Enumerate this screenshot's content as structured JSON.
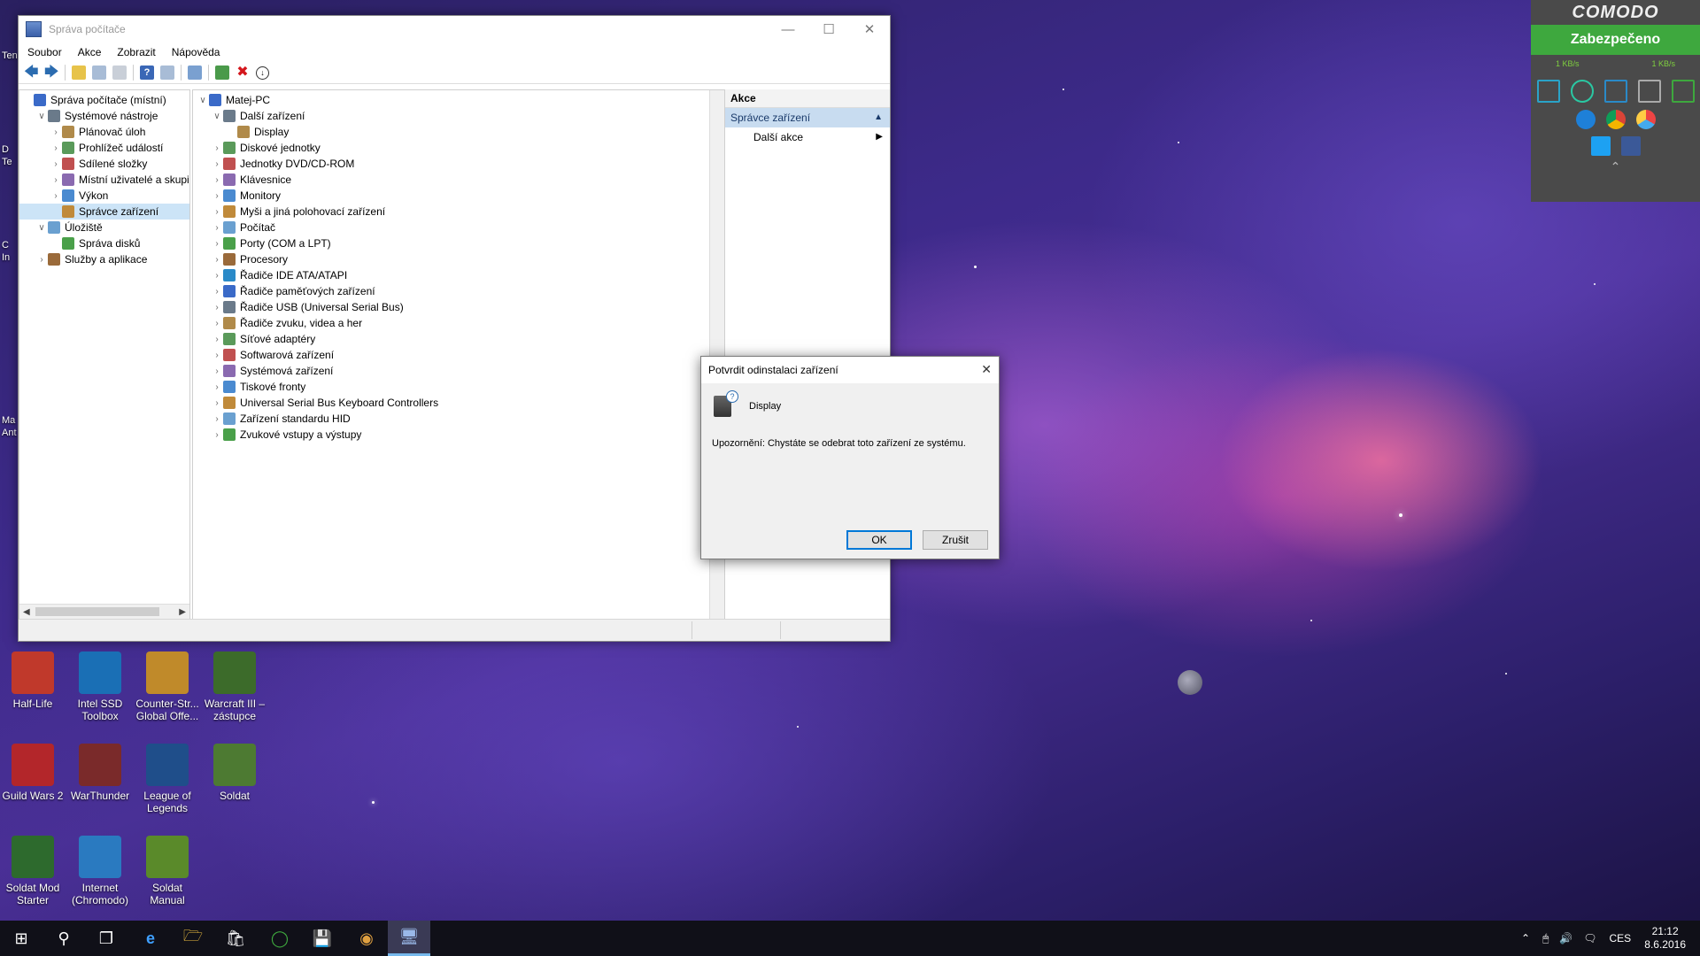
{
  "window": {
    "title": "Správa počítače",
    "menu": [
      "Soubor",
      "Akce",
      "Zobrazit",
      "Nápověda"
    ],
    "left_tree": [
      {
        "label": "Správa počítače (místní)",
        "indent": 0,
        "toggle": ""
      },
      {
        "label": "Systémové nástroje",
        "indent": 1,
        "toggle": "v"
      },
      {
        "label": "Plánovač úloh",
        "indent": 2,
        "toggle": ">"
      },
      {
        "label": "Prohlížeč událostí",
        "indent": 2,
        "toggle": ">"
      },
      {
        "label": "Sdílené složky",
        "indent": 2,
        "toggle": ">"
      },
      {
        "label": "Místní uživatelé a skupiny",
        "indent": 2,
        "toggle": ">"
      },
      {
        "label": "Výkon",
        "indent": 2,
        "toggle": ">"
      },
      {
        "label": "Správce zařízení",
        "indent": 2,
        "toggle": "",
        "selected": true
      },
      {
        "label": "Úložiště",
        "indent": 1,
        "toggle": "v"
      },
      {
        "label": "Správa disků",
        "indent": 2,
        "toggle": ""
      },
      {
        "label": "Služby a aplikace",
        "indent": 1,
        "toggle": ">"
      }
    ],
    "device_tree": [
      {
        "label": "Matej-PC",
        "indent": 0,
        "toggle": "v"
      },
      {
        "label": "Další zařízení",
        "indent": 1,
        "toggle": "v"
      },
      {
        "label": "Display",
        "indent": 2,
        "toggle": ""
      },
      {
        "label": "Diskové jednotky",
        "indent": 1,
        "toggle": ">"
      },
      {
        "label": "Jednotky DVD/CD-ROM",
        "indent": 1,
        "toggle": ">"
      },
      {
        "label": "Klávesnice",
        "indent": 1,
        "toggle": ">"
      },
      {
        "label": "Monitory",
        "indent": 1,
        "toggle": ">"
      },
      {
        "label": "Myši a jiná polohovací zařízení",
        "indent": 1,
        "toggle": ">"
      },
      {
        "label": "Počítač",
        "indent": 1,
        "toggle": ">"
      },
      {
        "label": "Porty (COM a LPT)",
        "indent": 1,
        "toggle": ">"
      },
      {
        "label": "Procesory",
        "indent": 1,
        "toggle": ">"
      },
      {
        "label": "Řadiče IDE ATA/ATAPI",
        "indent": 1,
        "toggle": ">"
      },
      {
        "label": "Řadiče paměťových zařízení",
        "indent": 1,
        "toggle": ">"
      },
      {
        "label": "Řadiče USB (Universal Serial Bus)",
        "indent": 1,
        "toggle": ">"
      },
      {
        "label": "Řadiče zvuku, videa a her",
        "indent": 1,
        "toggle": ">"
      },
      {
        "label": "Síťové adaptéry",
        "indent": 1,
        "toggle": ">"
      },
      {
        "label": "Softwarová zařízení",
        "indent": 1,
        "toggle": ">"
      },
      {
        "label": "Systémová zařízení",
        "indent": 1,
        "toggle": ">"
      },
      {
        "label": "Tiskové fronty",
        "indent": 1,
        "toggle": ">"
      },
      {
        "label": "Universal Serial Bus Keyboard Controllers",
        "indent": 1,
        "toggle": ">"
      },
      {
        "label": "Zařízení standardu HID",
        "indent": 1,
        "toggle": ">"
      },
      {
        "label": "Zvukové vstupy a výstupy",
        "indent": 1,
        "toggle": ">"
      }
    ],
    "actions": {
      "header": "Akce",
      "selected": "Správce zařízení",
      "more": "Další akce"
    }
  },
  "dialog": {
    "title": "Potvrdit odinstalaci zařízení",
    "device": "Display",
    "warning": "Upozornění: Chystáte se odebrat toto zařízení ze systému.",
    "ok": "OK",
    "cancel": "Zrušit"
  },
  "comodo": {
    "brand": "COMODO",
    "status": "Zabezpečeno",
    "speed_left": "1 KB/s",
    "speed_right": "1 KB/s"
  },
  "desktop_icons": [
    {
      "label": "Half-Life",
      "color": "#c0392b"
    },
    {
      "label": "Intel SSD Toolbox",
      "color": "#1a6fb5"
    },
    {
      "label": "Counter-Str... Global Offe...",
      "color": "#c08a2a"
    },
    {
      "label": "Warcraft III – zástupce",
      "color": "#3c6b2a"
    },
    {
      "label": "Guild Wars 2",
      "color": "#b3262a"
    },
    {
      "label": "WarThunder",
      "color": "#7a2a2a"
    },
    {
      "label": "League of Legends",
      "color": "#1f4e8a"
    },
    {
      "label": "Soldat",
      "color": "#4d7a32"
    },
    {
      "label": "Soldat Mod Starter",
      "color": "#2d6a2d"
    },
    {
      "label": "Internet (Chromodo)",
      "color": "#2a7ac0"
    },
    {
      "label": "Soldat Manual",
      "color": "#5a8a2a"
    }
  ],
  "left_edge_labels": [
    "Ten",
    "D",
    "Te",
    "C",
    "In",
    "Ma",
    "Ant"
  ],
  "tray": {
    "language": "CES",
    "time": "21:12",
    "date": "8.6.2016"
  }
}
